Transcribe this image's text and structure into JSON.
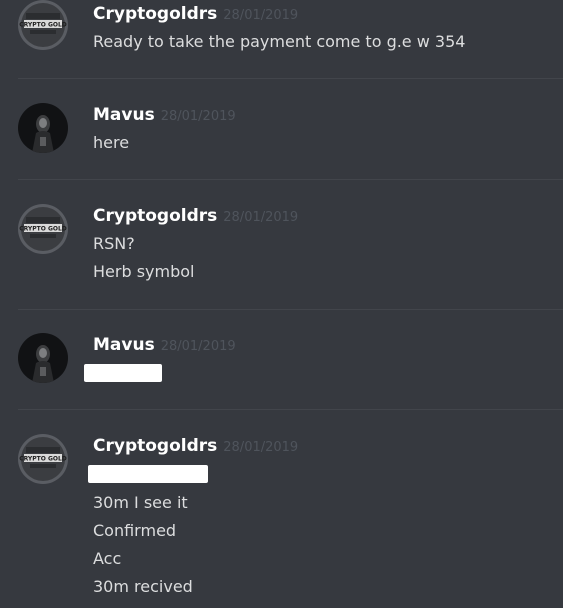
{
  "messages": [
    {
      "author": "Cryptogoldrs",
      "avatar_icon": "crypto-gold-logo-icon",
      "timestamp": "28/01/2019",
      "lines": [
        "Ready to take the payment come to g.e w 354"
      ]
    },
    {
      "author": "Mavus",
      "avatar_icon": "dark-hooded-figure-icon",
      "timestamp": "28/01/2019",
      "lines": [
        "here"
      ]
    },
    {
      "author": "Cryptogoldrs",
      "avatar_icon": "crypto-gold-logo-icon",
      "timestamp": "28/01/2019",
      "lines": [
        "RSN?",
        "Herb symbol"
      ]
    },
    {
      "author": "Mavus",
      "avatar_icon": "dark-hooded-figure-icon",
      "timestamp": "28/01/2019",
      "lines": []
    },
    {
      "author": "Cryptogoldrs",
      "avatar_icon": "crypto-gold-logo-icon",
      "timestamp": "28/01/2019",
      "lines": [
        "30m I see it",
        "Confirmed",
        "Acc",
        "30m recived"
      ]
    }
  ],
  "avatar_logo_text": "CRYPTO GOLD",
  "colors": {
    "background": "#36393f",
    "author": "#ffffff",
    "timestamp": "#4f545c",
    "message_text": "#dcddde",
    "divider": "#42454b",
    "redaction": "#ffffff"
  }
}
